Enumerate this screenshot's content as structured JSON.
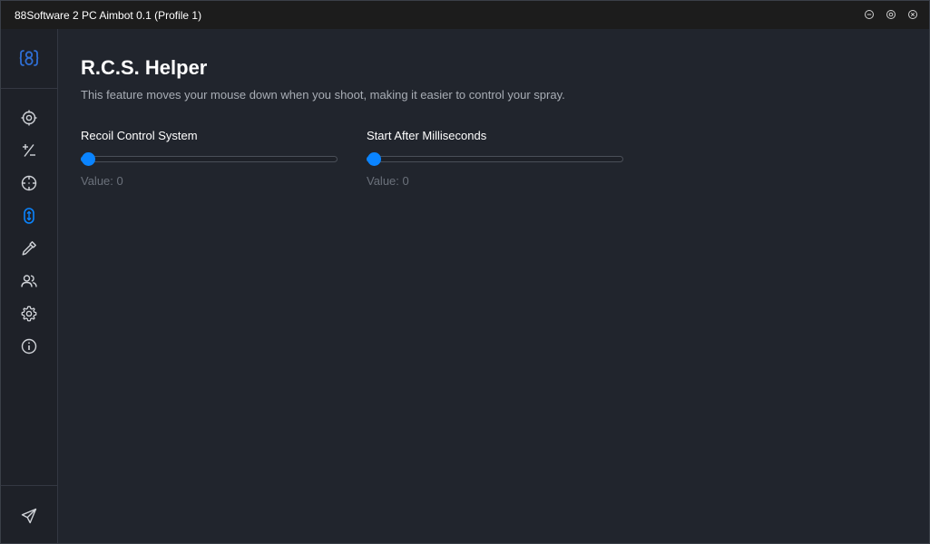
{
  "window": {
    "title": "88Software 2 PC Aimbot 0.1 (Profile 1)",
    "controls": [
      {
        "name": "minimize-icon"
      },
      {
        "name": "maximize-icon"
      },
      {
        "name": "close-icon"
      }
    ]
  },
  "sidebar": {
    "logo": "88-logo-icon",
    "items": [
      {
        "name": "crosshair-icon",
        "active": false
      },
      {
        "name": "plus-minus-icon",
        "active": false
      },
      {
        "name": "target-icon",
        "active": false
      },
      {
        "name": "mouse-vertical-icon",
        "active": true
      },
      {
        "name": "eyedropper-icon",
        "active": false
      },
      {
        "name": "users-icon",
        "active": false
      },
      {
        "name": "gear-icon",
        "active": false
      },
      {
        "name": "info-icon",
        "active": false
      }
    ],
    "bottom_item": {
      "name": "send-icon"
    }
  },
  "main": {
    "title": "R.C.S. Helper",
    "description": "This feature moves your mouse down when you shoot, making it easier to control your spray.",
    "sliders": [
      {
        "label": "Recoil Control System",
        "value_text": "Value: 0",
        "level": 0
      },
      {
        "label": "Start After Milliseconds",
        "value_text": "Value: 0",
        "level": 0
      }
    ]
  },
  "colors": {
    "accent": "#0a84ff",
    "background": "#21252d",
    "sidebar": "#1e2128",
    "titlebar": "#1c1c1c",
    "icon": "#d0d3d8"
  }
}
